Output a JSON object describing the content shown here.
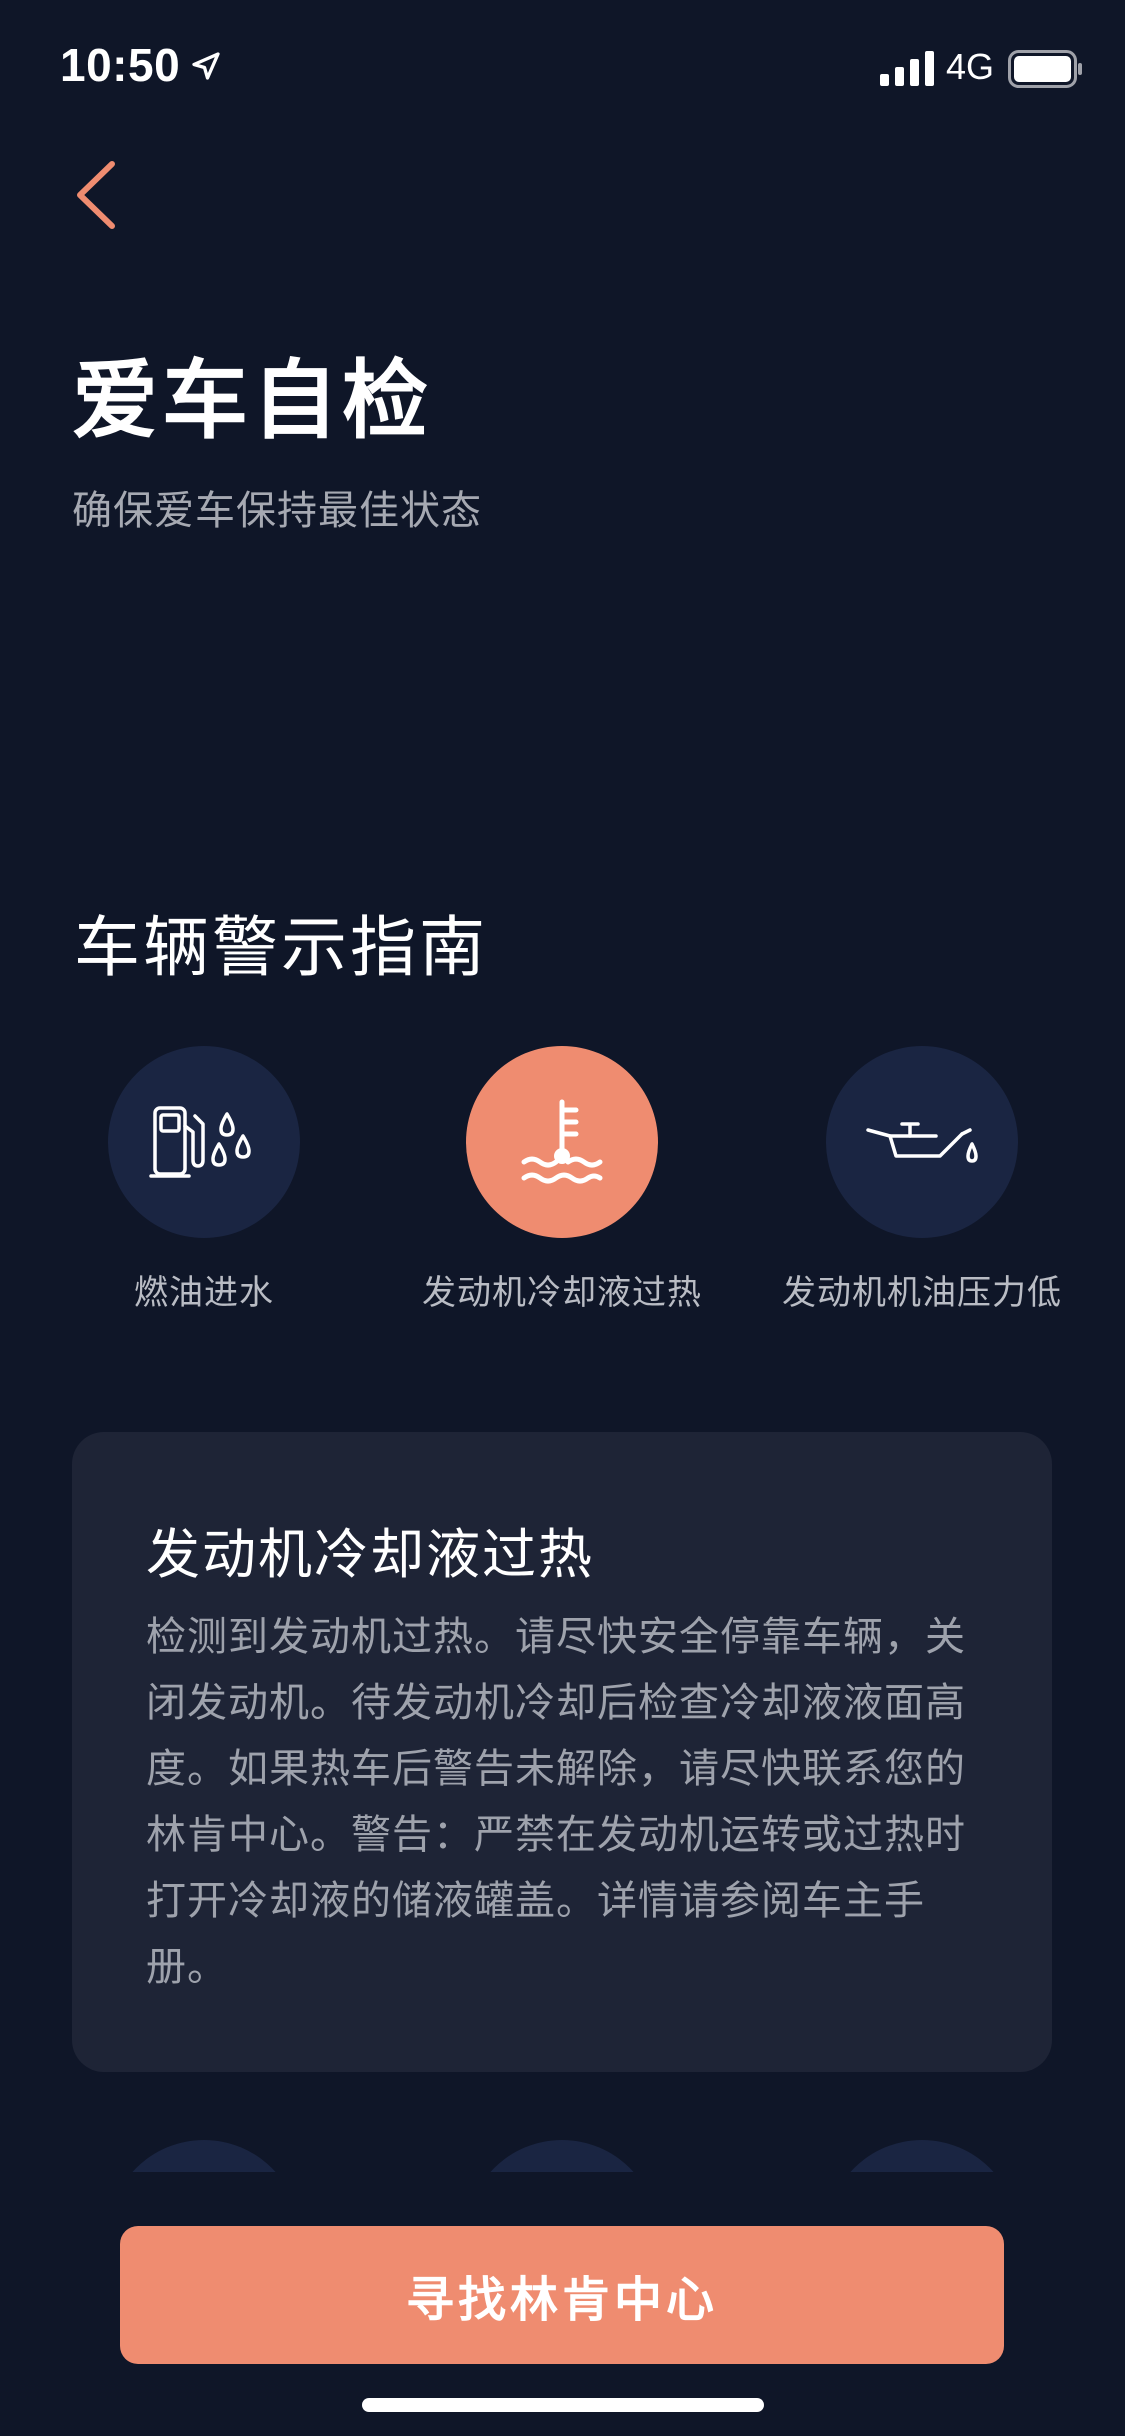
{
  "status_bar": {
    "time": "10:50",
    "network": "4G",
    "icons": [
      "location-arrow-icon",
      "signal-bars-icon",
      "battery-icon"
    ]
  },
  "header": {
    "back_icon": "chevron-left-icon",
    "title": "爱车自检",
    "subtitle": "确保爱车保持最佳状态"
  },
  "guide": {
    "section_title": "车辆警示指南",
    "items": [
      {
        "label": "燃油进水",
        "icon": "fuel-water-icon",
        "selected": false
      },
      {
        "label": "发动机冷却液过热",
        "icon": "coolant-temperature-icon",
        "selected": true
      },
      {
        "label": "发动机机油压力低",
        "icon": "oil-can-icon",
        "selected": false
      }
    ]
  },
  "detail": {
    "title": "发动机冷却液过热",
    "body": "检测到发动机过热。请尽快安全停靠车辆，关闭发动机。待发动机冷却后检查冷却液液面高度。如果热车后警告未解除，请尽快联系您的林肯中心。警告：严禁在发动机运转或过热时打开冷却液的储液罐盖。详情请参阅车主手册。"
  },
  "cta": {
    "label": "寻找林肯中心"
  },
  "colors": {
    "background": "#0f1628",
    "accent": "#ef8c70",
    "card": "#1e2436",
    "icon_circle": "#1a2542"
  }
}
